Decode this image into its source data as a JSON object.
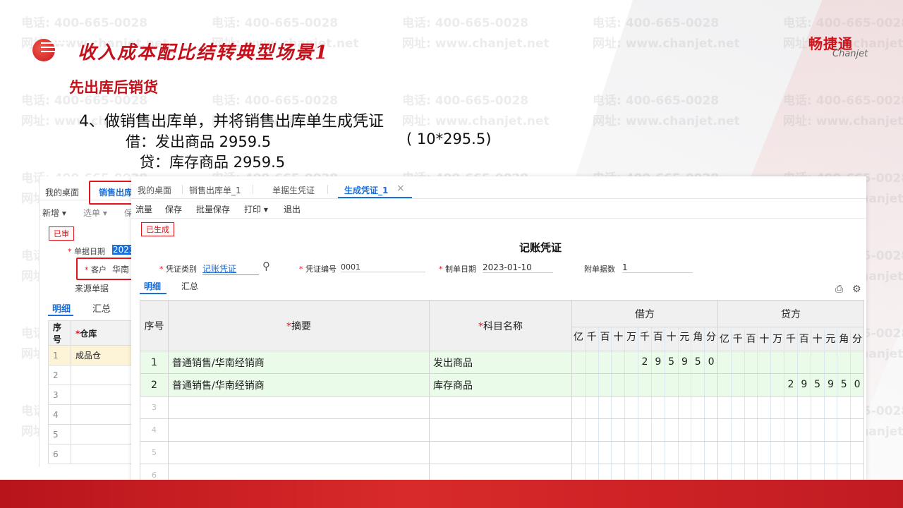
{
  "watermark": {
    "phone": "电话: 400-665-0028",
    "site": "网址: www.chanjet.net"
  },
  "header": {
    "title": "收入成本配比结转典型场景1",
    "brand_cn": "畅捷通",
    "brand_en": "Chanjet"
  },
  "slide": {
    "subtitle": "先出库后销货",
    "step": "4、做销售出库单，并将销售出库单生成凭证",
    "debit_line": "借：发出商品    2959.5",
    "debit_calc": "( 10*295.5)",
    "credit_line": "贷：库存商品   2959.5"
  },
  "bg_app": {
    "tabs": [
      "我的桌面",
      "销售出库"
    ],
    "toolbar": [
      "新增",
      "选单",
      "保"
    ],
    "status": "已审",
    "date_label": "单据日期",
    "date_value": "2023",
    "customer_label": "客户",
    "customer_value": "华南",
    "source_label": "来源单据",
    "sub_tabs": [
      "明细",
      "汇总"
    ],
    "table_headers": [
      "序号",
      "仓库"
    ],
    "rows": [
      {
        "no": "1",
        "warehouse": "成品仓"
      },
      {
        "no": "2",
        "warehouse": ""
      },
      {
        "no": "3",
        "warehouse": ""
      },
      {
        "no": "4",
        "warehouse": ""
      },
      {
        "no": "5",
        "warehouse": ""
      },
      {
        "no": "6",
        "warehouse": ""
      }
    ]
  },
  "app": {
    "tabs": [
      "我的桌面",
      "销售出库单_1",
      "单据生凭证",
      "生成凭证_1"
    ],
    "active_tab": "生成凭证_1",
    "close_icon": "×",
    "toolbar": [
      "流量",
      "保存",
      "批量保存",
      "打印",
      "退出"
    ],
    "status": "已生成",
    "doc_title": "记账凭证",
    "fields": {
      "voucher_type_label": "凭证类别",
      "voucher_type_value": "记账凭证",
      "voucher_no_label": "凭证编号",
      "voucher_no_value": "0001",
      "date_label": "制单日期",
      "date_value": "2023-01-10",
      "attach_label": "附单据数",
      "attach_value": "1"
    },
    "sub_tabs": [
      "明细",
      "汇总"
    ],
    "columns": {
      "no": "序号",
      "summary": "摘要",
      "account": "科目名称",
      "debit": "借方",
      "credit": "贷方",
      "digits": [
        "亿",
        "千",
        "百",
        "十",
        "万",
        "千",
        "百",
        "十",
        "元",
        "角",
        "分"
      ]
    },
    "rows": [
      {
        "no": "1",
        "summary": "普通销售/华南经销商",
        "account": "发出商品",
        "debit": [
          "",
          "",
          "",
          "",
          "",
          "2",
          "9",
          "5",
          "9",
          "5",
          "0"
        ],
        "credit": [
          "",
          "",
          "",
          "",
          "",
          "",
          "",
          "",
          "",
          "",
          ""
        ]
      },
      {
        "no": "2",
        "summary": "普通销售/华南经销商",
        "account": "库存商品",
        "debit": [
          "",
          "",
          "",
          "",
          "",
          "",
          "",
          "",
          "",
          "",
          ""
        ],
        "credit": [
          "",
          "",
          "",
          "",
          "",
          "2",
          "9",
          "5",
          "9",
          "5",
          "0"
        ]
      },
      {
        "no": "3",
        "summary": "",
        "account": "",
        "debit": [],
        "credit": []
      },
      {
        "no": "4",
        "summary": "",
        "account": "",
        "debit": [],
        "credit": []
      },
      {
        "no": "5",
        "summary": "",
        "account": "",
        "debit": [],
        "credit": []
      },
      {
        "no": "6",
        "summary": "",
        "account": "",
        "debit": [],
        "credit": []
      }
    ]
  }
}
